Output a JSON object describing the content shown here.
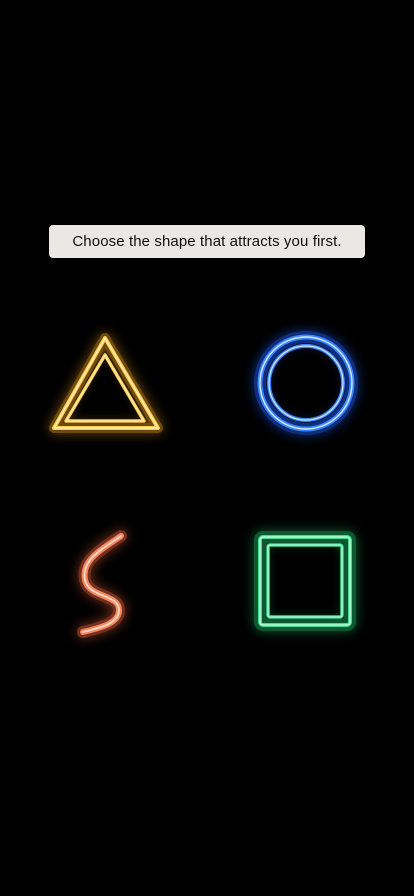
{
  "prompt": {
    "text": "Choose the shape that attracts you first."
  },
  "shapes": [
    {
      "id": "triangle",
      "icon": "neon-triangle-icon",
      "color": "#f4b63a"
    },
    {
      "id": "circle",
      "icon": "neon-circle-icon",
      "color": "#2f7bff"
    },
    {
      "id": "wave",
      "icon": "neon-s-curve-icon",
      "color": "#f07a52"
    },
    {
      "id": "square",
      "icon": "neon-square-icon",
      "color": "#39d587"
    }
  ]
}
